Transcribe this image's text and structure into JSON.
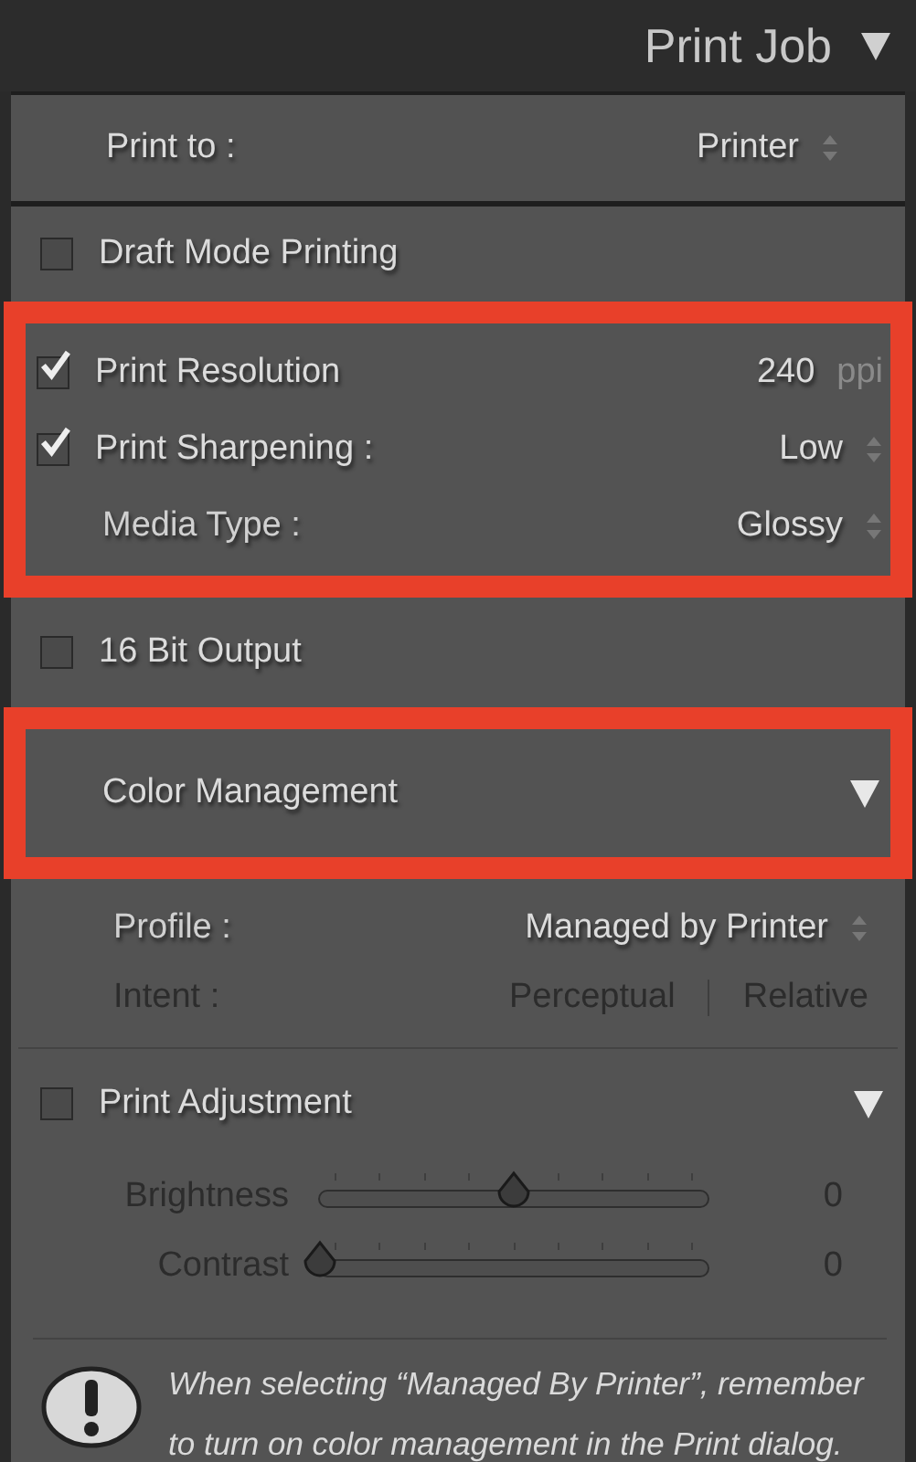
{
  "panel": {
    "title": "Print Job",
    "expanded": true
  },
  "print_to": {
    "label": "Print to :",
    "value": "Printer"
  },
  "groups": [
    {
      "highlighted": false,
      "rows": [
        {
          "kind": "checkbox",
          "label": "Draft Mode Printing",
          "checked": false
        }
      ]
    },
    {
      "highlighted": true,
      "rows": [
        {
          "kind": "checkbox",
          "label": "Print Resolution",
          "checked": true,
          "value": "240",
          "unit": "ppi"
        },
        {
          "kind": "checkbox",
          "label": "Print Sharpening :",
          "checked": true,
          "value": "Low"
        },
        {
          "kind": "select",
          "label": "Media Type :",
          "value": "Glossy"
        }
      ]
    },
    {
      "highlighted": false,
      "rows": [
        {
          "kind": "checkbox",
          "label": "16 Bit Output",
          "checked": false
        }
      ]
    },
    {
      "highlighted": true,
      "rows": [
        {
          "kind": "section",
          "label": "Color Management",
          "expanded": true
        }
      ]
    },
    {
      "highlighted": false,
      "rows": [
        {
          "kind": "select",
          "label": "Profile :",
          "value": "Managed by Printer"
        },
        {
          "kind": "intent",
          "label": "Intent :",
          "disabled": true,
          "options": [
            "Perceptual",
            "Relative"
          ]
        }
      ]
    },
    {
      "highlighted": false,
      "rows": [
        {
          "kind": "section",
          "label": "Print Adjustment",
          "checked": false,
          "expanded": true
        },
        {
          "kind": "slider",
          "label": "Brightness",
          "level": 0.5,
          "reading": "0",
          "disabled": true
        },
        {
          "kind": "slider",
          "label": "Contrast",
          "level": 0,
          "reading": "0",
          "disabled": true
        }
      ]
    }
  ],
  "note": {
    "text": "When selecting “Managed By Printer”, remember to turn on color management in the Print dialog."
  }
}
